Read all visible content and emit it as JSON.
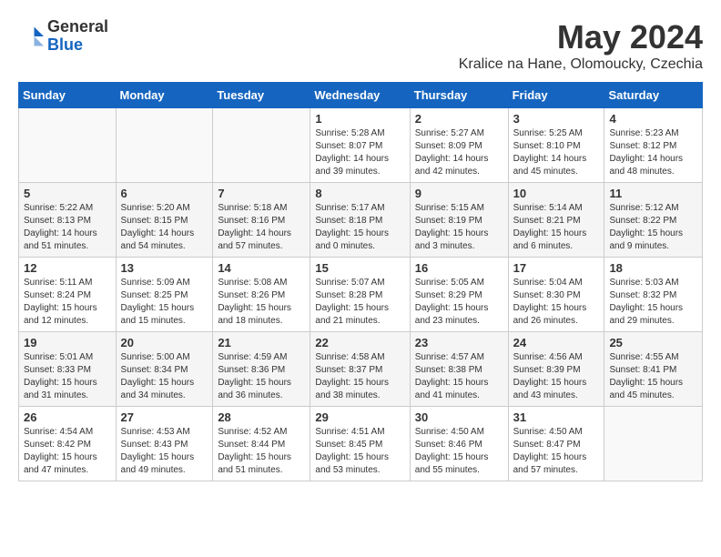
{
  "logo": {
    "general": "General",
    "blue": "Blue"
  },
  "header": {
    "title": "May 2024",
    "subtitle": "Kralice na Hane, Olomoucky, Czechia"
  },
  "days_of_week": [
    "Sunday",
    "Monday",
    "Tuesday",
    "Wednesday",
    "Thursday",
    "Friday",
    "Saturday"
  ],
  "weeks": [
    [
      {
        "day": "",
        "info": ""
      },
      {
        "day": "",
        "info": ""
      },
      {
        "day": "",
        "info": ""
      },
      {
        "day": "1",
        "info": "Sunrise: 5:28 AM\nSunset: 8:07 PM\nDaylight: 14 hours and 39 minutes."
      },
      {
        "day": "2",
        "info": "Sunrise: 5:27 AM\nSunset: 8:09 PM\nDaylight: 14 hours and 42 minutes."
      },
      {
        "day": "3",
        "info": "Sunrise: 5:25 AM\nSunset: 8:10 PM\nDaylight: 14 hours and 45 minutes."
      },
      {
        "day": "4",
        "info": "Sunrise: 5:23 AM\nSunset: 8:12 PM\nDaylight: 14 hours and 48 minutes."
      }
    ],
    [
      {
        "day": "5",
        "info": "Sunrise: 5:22 AM\nSunset: 8:13 PM\nDaylight: 14 hours and 51 minutes."
      },
      {
        "day": "6",
        "info": "Sunrise: 5:20 AM\nSunset: 8:15 PM\nDaylight: 14 hours and 54 minutes."
      },
      {
        "day": "7",
        "info": "Sunrise: 5:18 AM\nSunset: 8:16 PM\nDaylight: 14 hours and 57 minutes."
      },
      {
        "day": "8",
        "info": "Sunrise: 5:17 AM\nSunset: 8:18 PM\nDaylight: 15 hours and 0 minutes."
      },
      {
        "day": "9",
        "info": "Sunrise: 5:15 AM\nSunset: 8:19 PM\nDaylight: 15 hours and 3 minutes."
      },
      {
        "day": "10",
        "info": "Sunrise: 5:14 AM\nSunset: 8:21 PM\nDaylight: 15 hours and 6 minutes."
      },
      {
        "day": "11",
        "info": "Sunrise: 5:12 AM\nSunset: 8:22 PM\nDaylight: 15 hours and 9 minutes."
      }
    ],
    [
      {
        "day": "12",
        "info": "Sunrise: 5:11 AM\nSunset: 8:24 PM\nDaylight: 15 hours and 12 minutes."
      },
      {
        "day": "13",
        "info": "Sunrise: 5:09 AM\nSunset: 8:25 PM\nDaylight: 15 hours and 15 minutes."
      },
      {
        "day": "14",
        "info": "Sunrise: 5:08 AM\nSunset: 8:26 PM\nDaylight: 15 hours and 18 minutes."
      },
      {
        "day": "15",
        "info": "Sunrise: 5:07 AM\nSunset: 8:28 PM\nDaylight: 15 hours and 21 minutes."
      },
      {
        "day": "16",
        "info": "Sunrise: 5:05 AM\nSunset: 8:29 PM\nDaylight: 15 hours and 23 minutes."
      },
      {
        "day": "17",
        "info": "Sunrise: 5:04 AM\nSunset: 8:30 PM\nDaylight: 15 hours and 26 minutes."
      },
      {
        "day": "18",
        "info": "Sunrise: 5:03 AM\nSunset: 8:32 PM\nDaylight: 15 hours and 29 minutes."
      }
    ],
    [
      {
        "day": "19",
        "info": "Sunrise: 5:01 AM\nSunset: 8:33 PM\nDaylight: 15 hours and 31 minutes."
      },
      {
        "day": "20",
        "info": "Sunrise: 5:00 AM\nSunset: 8:34 PM\nDaylight: 15 hours and 34 minutes."
      },
      {
        "day": "21",
        "info": "Sunrise: 4:59 AM\nSunset: 8:36 PM\nDaylight: 15 hours and 36 minutes."
      },
      {
        "day": "22",
        "info": "Sunrise: 4:58 AM\nSunset: 8:37 PM\nDaylight: 15 hours and 38 minutes."
      },
      {
        "day": "23",
        "info": "Sunrise: 4:57 AM\nSunset: 8:38 PM\nDaylight: 15 hours and 41 minutes."
      },
      {
        "day": "24",
        "info": "Sunrise: 4:56 AM\nSunset: 8:39 PM\nDaylight: 15 hours and 43 minutes."
      },
      {
        "day": "25",
        "info": "Sunrise: 4:55 AM\nSunset: 8:41 PM\nDaylight: 15 hours and 45 minutes."
      }
    ],
    [
      {
        "day": "26",
        "info": "Sunrise: 4:54 AM\nSunset: 8:42 PM\nDaylight: 15 hours and 47 minutes."
      },
      {
        "day": "27",
        "info": "Sunrise: 4:53 AM\nSunset: 8:43 PM\nDaylight: 15 hours and 49 minutes."
      },
      {
        "day": "28",
        "info": "Sunrise: 4:52 AM\nSunset: 8:44 PM\nDaylight: 15 hours and 51 minutes."
      },
      {
        "day": "29",
        "info": "Sunrise: 4:51 AM\nSunset: 8:45 PM\nDaylight: 15 hours and 53 minutes."
      },
      {
        "day": "30",
        "info": "Sunrise: 4:50 AM\nSunset: 8:46 PM\nDaylight: 15 hours and 55 minutes."
      },
      {
        "day": "31",
        "info": "Sunrise: 4:50 AM\nSunset: 8:47 PM\nDaylight: 15 hours and 57 minutes."
      },
      {
        "day": "",
        "info": ""
      }
    ]
  ]
}
